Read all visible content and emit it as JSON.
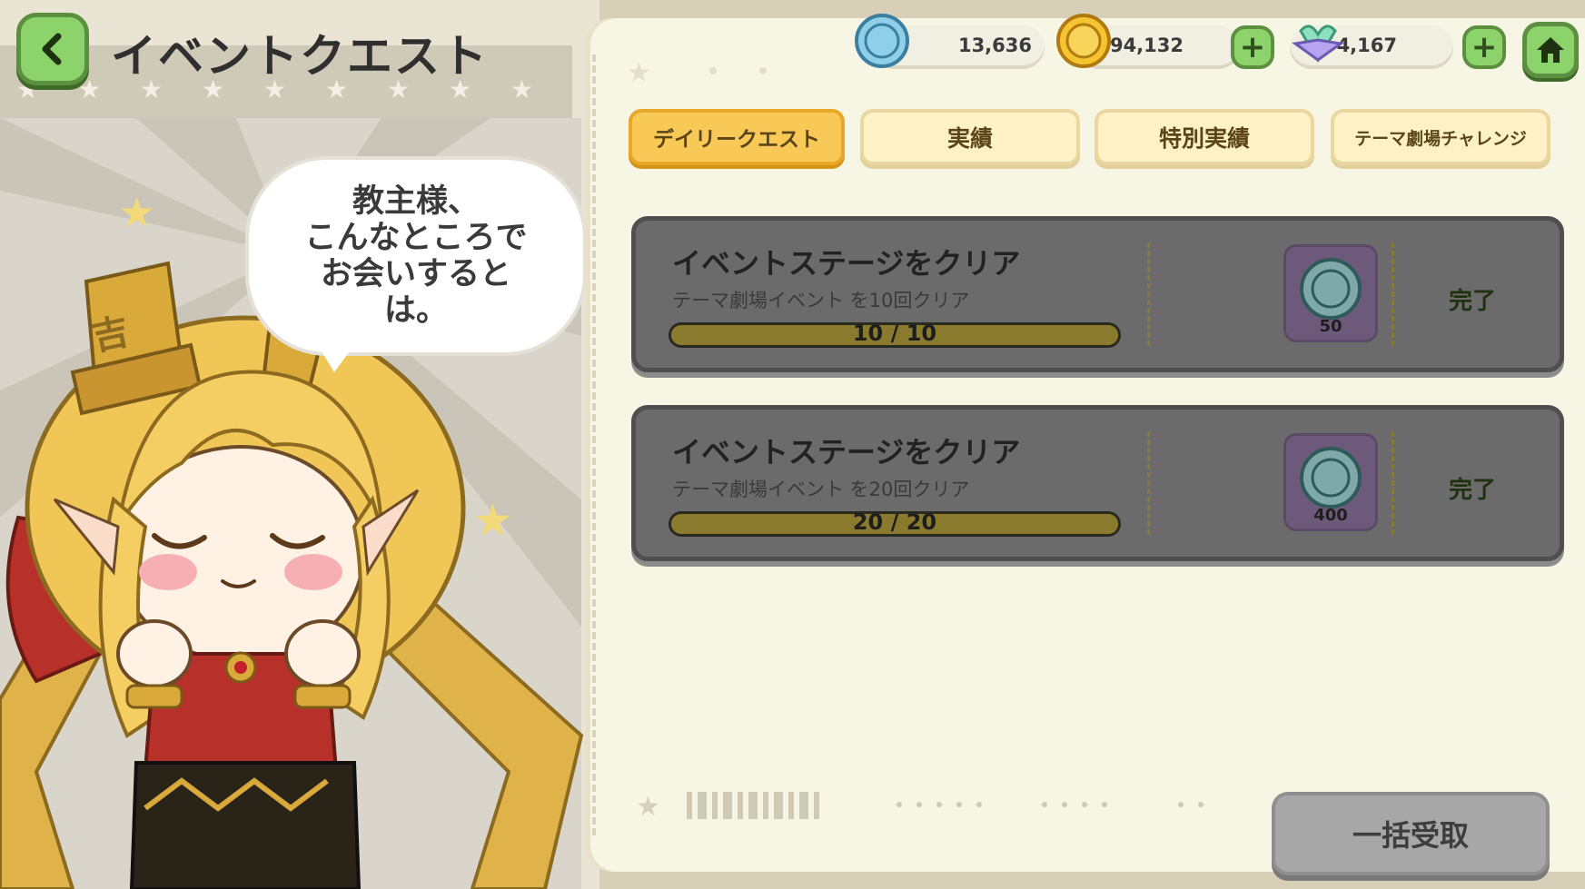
{
  "header": {
    "title": "イベントクエスト"
  },
  "speech_bubble": {
    "text": "教主様、\nこんなところで\nお会いすると\nは。"
  },
  "currencies": [
    {
      "icon": "tea-coin-icon",
      "value": "13,636"
    },
    {
      "icon": "gold-coin-icon",
      "value": "6,194,132"
    },
    {
      "icon": "flower-gem-icon",
      "value": "4,167"
    }
  ],
  "tabs": [
    {
      "label": "デイリークエスト",
      "active": true
    },
    {
      "label": "実績",
      "active": false
    },
    {
      "label": "特別実績",
      "active": false
    },
    {
      "label": "テーマ劇場チャレンジ",
      "active": false
    }
  ],
  "quests": [
    {
      "title": "イベントステージをクリア",
      "desc": "テーマ劇場イベント を10回クリア",
      "progress_text": "10 / 10",
      "progress": 1.0,
      "reward_amount": "50",
      "status": "完了"
    },
    {
      "title": "イベントステージをクリア",
      "desc": "テーマ劇場イベント を20回クリア",
      "progress_text": "20 / 20",
      "progress": 1.0,
      "reward_amount": "400",
      "status": "完了"
    }
  ],
  "bulk_button": {
    "label": "一括受取"
  },
  "colors": {
    "accent_green": "#8bd36a",
    "tab_active": "#f9c958",
    "tab_inactive": "#fdf1c5",
    "card_gray": "#6b6b6b"
  }
}
